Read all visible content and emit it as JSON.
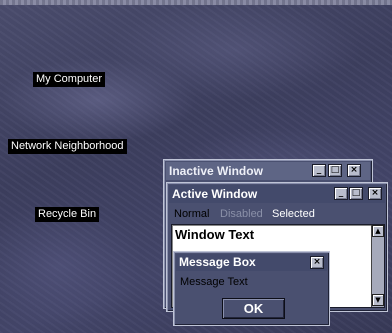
{
  "desktop": {
    "icons": [
      {
        "label": "My Computer"
      },
      {
        "label": "Network Neighborhood"
      },
      {
        "label": "Recycle Bin"
      }
    ]
  },
  "inactive_window": {
    "title": "Inactive Window",
    "buttons": [
      "_",
      "□",
      "×"
    ]
  },
  "active_window": {
    "title": "Active Window",
    "buttons": [
      "_",
      "□",
      "×"
    ],
    "menu": {
      "normal": "Normal",
      "disabled": "Disabled",
      "selected": "Selected"
    },
    "window_text": "Window Text"
  },
  "message_box": {
    "title": "Message Box",
    "close_button": "×",
    "message": "Message Text",
    "ok_label": "OK"
  },
  "colors": {
    "desktop": "#44466a",
    "window_frame": "#4a5070",
    "active_title": "#434a6b",
    "inactive_title": "#5e6585",
    "disabled_text": "#8a90a8",
    "window_background": "#ffffff"
  }
}
